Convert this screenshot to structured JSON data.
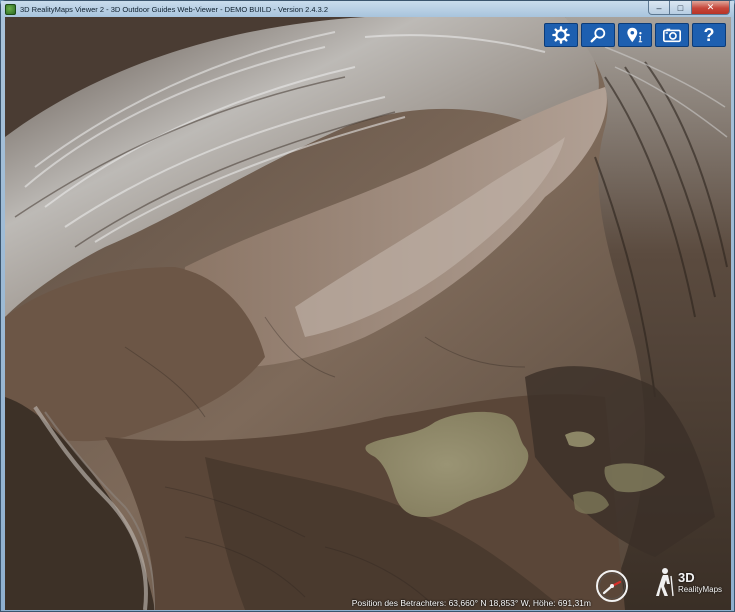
{
  "window": {
    "title": "3D RealityMaps Viewer 2 - 3D Outdoor Guides Web-Viewer - DEMO BUILD - Version 2.4.3.2",
    "controls": {
      "minimize": "–",
      "maximize": "□",
      "close": "✕"
    }
  },
  "toolbar": {
    "buttons": [
      {
        "icon": "gear-icon"
      },
      {
        "icon": "search-icon"
      },
      {
        "icon": "location-info-icon"
      },
      {
        "icon": "camera-icon"
      },
      {
        "icon": "help-icon",
        "label": "?"
      }
    ],
    "color": "#1d5fb0"
  },
  "status": {
    "position_text": "Position des Betrachters: 63,660° N 18,853° W, Höhe: 691,31m"
  },
  "logo": {
    "line1": "3D",
    "line2": "RealityMaps"
  },
  "colors": {
    "lake": "#8f8868",
    "rock": "#7d6756",
    "snow": "#e6e6e8"
  }
}
